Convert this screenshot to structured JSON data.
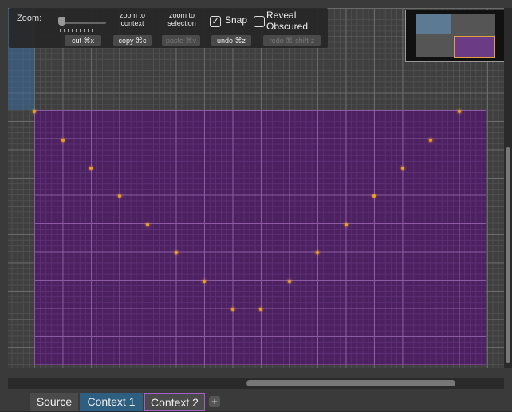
{
  "toolbar": {
    "zoom_label": "Zoom:",
    "zoom_to_context": "zoom to context",
    "zoom_to_selection": "zoom to selection",
    "snap_label": "Snap",
    "snap_checked": true,
    "snap_mark": "✓",
    "reveal_label": "Reveal Obscured",
    "reveal_checked": false,
    "cut": "cut ⌘x",
    "copy": "copy ⌘c",
    "paste": "paste ⌘v",
    "undo": "undo ⌘z",
    "redo": "redo ⌘-shift-z"
  },
  "tabs": {
    "source": "Source",
    "context1": "Context 1",
    "context2": "Context 2",
    "add": "+",
    "active": "Context 1"
  },
  "colors": {
    "grid_background": "#3f3f3f",
    "context_region": "#4c2160",
    "control_point": "#f0a020",
    "source_region": "#3c6ea0",
    "active_tab": "#2f5f80",
    "context2_outline": "#a060c8"
  },
  "icons": {
    "snap_checkbox": "checkmark-icon",
    "add_tab": "plus-icon"
  }
}
